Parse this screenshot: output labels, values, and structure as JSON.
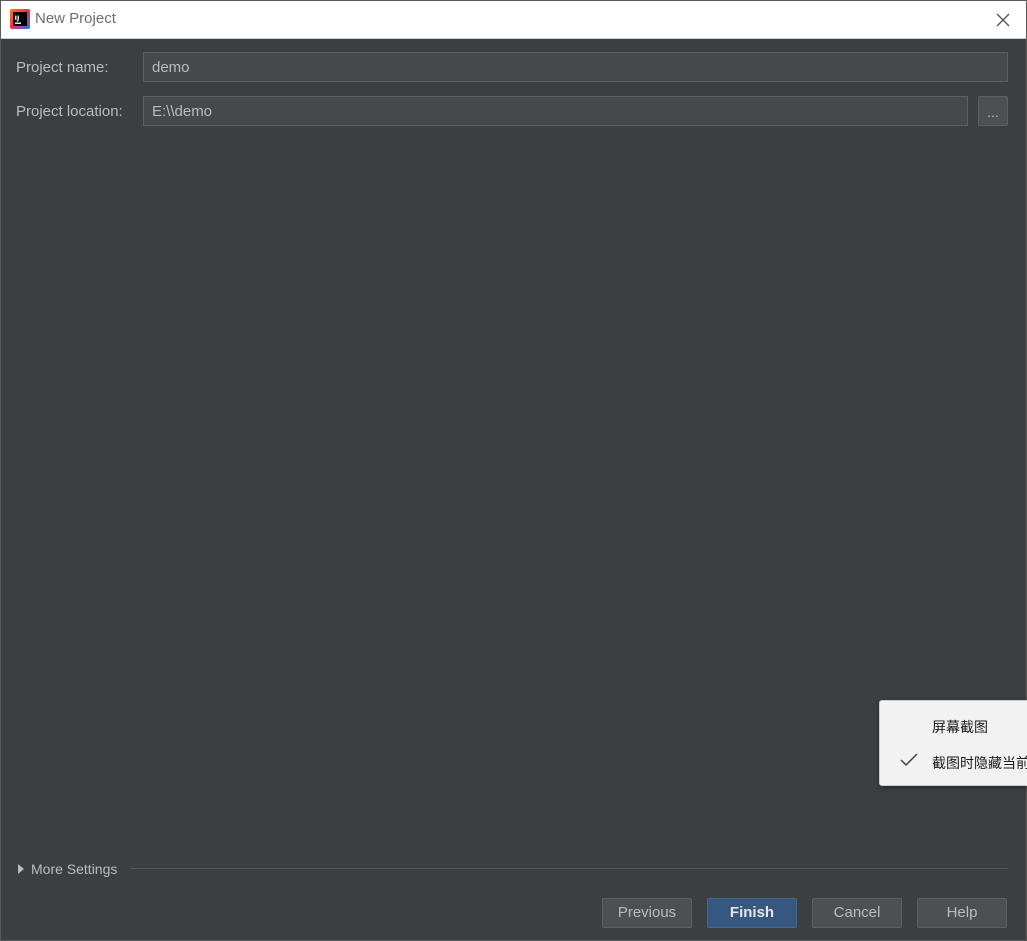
{
  "window": {
    "title": "New Project",
    "app_icon": "intellij-idea-icon",
    "close_icon": "close-icon"
  },
  "form": {
    "project_name": {
      "label": "Project name:",
      "value": "demo"
    },
    "project_location": {
      "label": "Project location:",
      "value": "E:\\\\demo",
      "browse_label": "..."
    }
  },
  "more_settings": {
    "label": "More Settings",
    "expand_icon": "triangle-right-icon"
  },
  "buttons": {
    "previous": "Previous",
    "finish": "Finish",
    "cancel": "Cancel",
    "help": "Help"
  },
  "context_menu": {
    "items": [
      {
        "label": "屏幕截图",
        "checked": false
      },
      {
        "label": "截图时隐藏当前",
        "checked": true
      }
    ],
    "check_icon": "checkmark-icon"
  },
  "colors": {
    "background": "#3c3f41",
    "input_background": "#45494a",
    "primary_button": "#365880",
    "text": "#bbbbbb"
  }
}
